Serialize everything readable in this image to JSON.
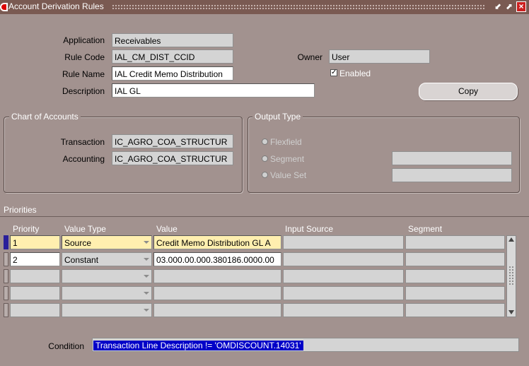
{
  "window": {
    "title": "Account Derivation Rules",
    "minimize_glyph": "⬋",
    "maximize_glyph": "⬈",
    "close_glyph": "×"
  },
  "header": {
    "application_label": "Application",
    "application_value": "Receivables",
    "rule_code_label": "Rule Code",
    "rule_code_value": "IAL_CM_DIST_CCID",
    "rule_name_label": "Rule Name",
    "rule_name_value": "IAL Credit Memo Distribution",
    "description_label": "Description",
    "description_value": "IAL GL",
    "owner_label": "Owner",
    "owner_value": "User",
    "enabled_label": "Enabled",
    "enabled_checked": true,
    "copy_button": "Copy"
  },
  "chart_of_accounts": {
    "title": "Chart of Accounts",
    "transaction_label": "Transaction",
    "transaction_value": "IC_AGRO_COA_STRUCTUR",
    "accounting_label": "Accounting",
    "accounting_value": "IC_AGRO_COA_STRUCTUR"
  },
  "output_type": {
    "title": "Output Type",
    "options": [
      "Flexfield",
      "Segment",
      "Value Set"
    ],
    "segment_value": "",
    "value_set_value": ""
  },
  "priorities": {
    "title": "Priorities",
    "columns": [
      "Priority",
      "Value Type",
      "Value",
      "Input Source",
      "Segment"
    ],
    "rows": [
      {
        "priority": "1",
        "value_type": "Source",
        "value": "Credit Memo Distribution GL A",
        "input_source": "",
        "segment": ""
      },
      {
        "priority": "2",
        "value_type": "Constant",
        "value": "03.000.00.000.380186.0000.00",
        "input_source": "",
        "segment": ""
      },
      {
        "priority": "",
        "value_type": "",
        "value": "",
        "input_source": "",
        "segment": ""
      },
      {
        "priority": "",
        "value_type": "",
        "value": "",
        "input_source": "",
        "segment": ""
      },
      {
        "priority": "",
        "value_type": "",
        "value": "",
        "input_source": "",
        "segment": ""
      }
    ]
  },
  "condition": {
    "label": "Condition",
    "value": "Transaction Line Description != 'OMDISCOUNT.14031'"
  }
}
